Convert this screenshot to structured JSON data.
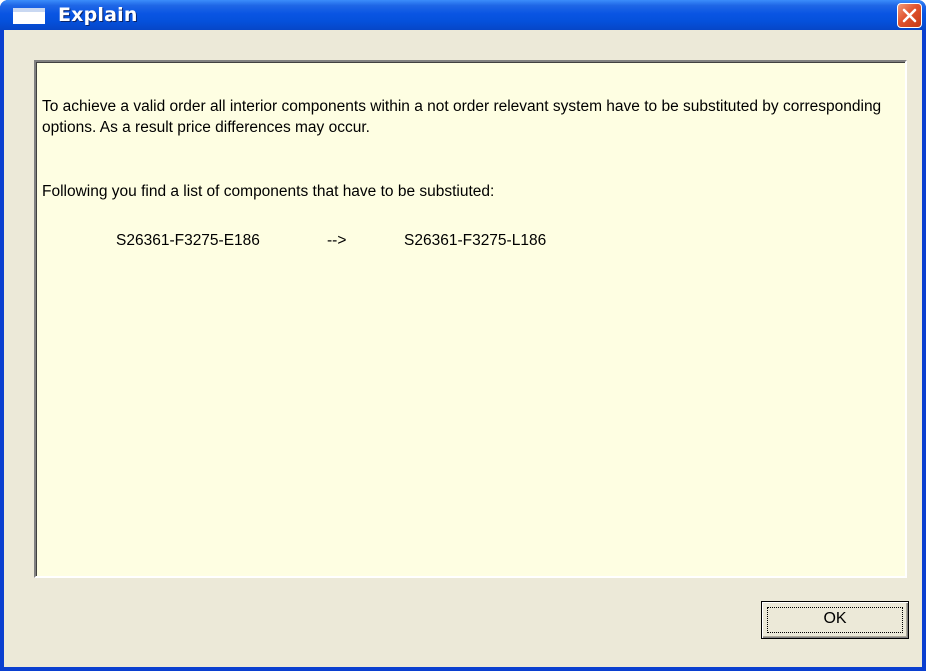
{
  "window": {
    "title": "Explain",
    "icon": "window-icon",
    "close_icon": "close-icon"
  },
  "message": {
    "paragraph1": "To achieve a valid order all interior components within a not order relevant system have to be substituted by corresponding options. As a result price differences may occur.",
    "paragraph2": "Following you find a list of components that have to be substiuted:",
    "substitutions": [
      {
        "from": "S26361-F3275-E186",
        "arrow": "-->",
        "to": "S26361-F3275-L186"
      }
    ]
  },
  "buttons": {
    "ok_label": "OK"
  },
  "colors": {
    "titlebar": "#0a55e3",
    "client_bg": "#ece9d8",
    "panel_bg": "#fefee2",
    "close_button": "#e0532e"
  }
}
